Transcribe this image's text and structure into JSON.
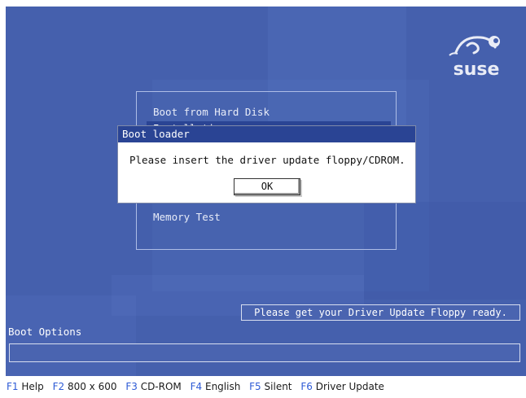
{
  "menu": {
    "items": [
      {
        "label": "Boot from Hard Disk",
        "selected": false
      },
      {
        "label": "Installation",
        "selected": true
      },
      {
        "label": "Memory Test",
        "selected": false
      }
    ]
  },
  "dialog": {
    "title": "Boot loader",
    "message": "Please insert the driver update floppy/CDROM.",
    "ok_label": "OK"
  },
  "hint": "Please get your Driver Update Floppy ready.",
  "boot_options": {
    "label": "Boot Options",
    "value": ""
  },
  "function_keys": [
    {
      "key": "F1",
      "label": "Help"
    },
    {
      "key": "F2",
      "label": "800 x 600"
    },
    {
      "key": "F3",
      "label": "CD-ROM"
    },
    {
      "key": "F4",
      "label": "English"
    },
    {
      "key": "F5",
      "label": "Silent"
    },
    {
      "key": "F6",
      "label": "Driver Update"
    }
  ],
  "logo_text": "suse",
  "colors": {
    "background": "#4560ad",
    "selection": "#2a4494",
    "fkey": "#2e5bd6"
  }
}
